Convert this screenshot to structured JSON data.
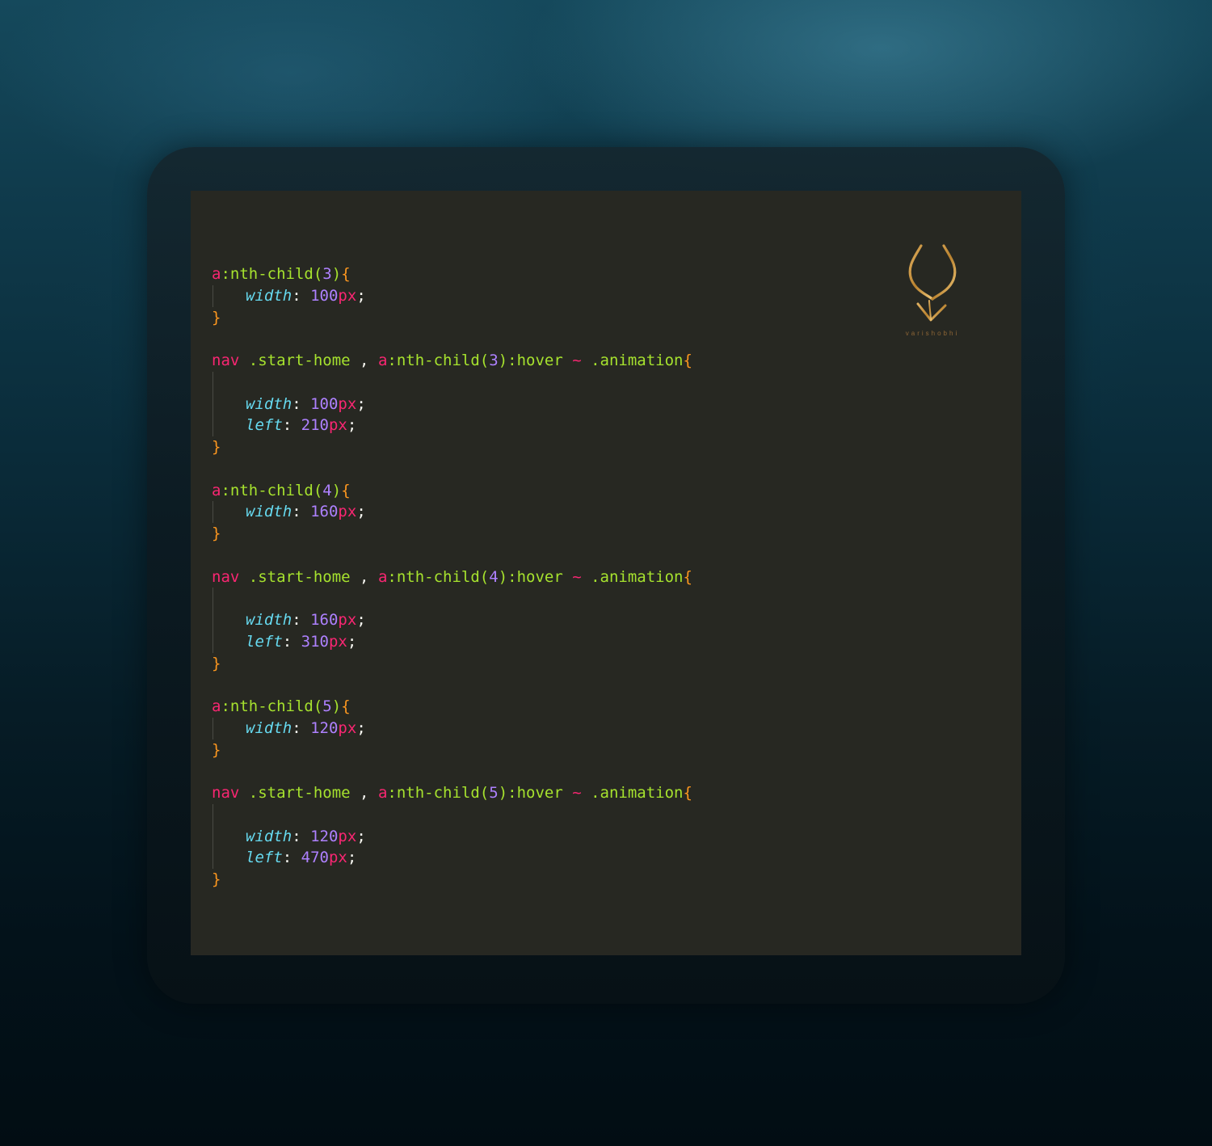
{
  "logo": {
    "icon": "antler-v-logo-icon",
    "text": "varishobhi",
    "color": "#c8923f"
  },
  "colors": {
    "panel_bg": "#272822",
    "tag": "#f92672",
    "selector": "#a6e22e",
    "number": "#ae81ff",
    "property": "#66d9ef",
    "brace": "#fd971f"
  },
  "code": {
    "blocks": [
      {
        "selector": [
          {
            "t": "a",
            "k": "tag"
          },
          {
            "t": ":nth-child(",
            "k": "sel"
          },
          {
            "t": "3",
            "k": "num"
          },
          {
            "t": ")",
            "k": "sel"
          },
          {
            "t": "{",
            "k": "brace"
          }
        ],
        "lines": [
          [
            {
              "t": "width",
              "k": "prop"
            },
            {
              "t": ": ",
              "k": "punc"
            },
            {
              "t": "100",
              "k": "num"
            },
            {
              "t": "px",
              "k": "unit"
            },
            {
              "t": ";",
              "k": "punc"
            }
          ]
        ]
      },
      {
        "selector": [
          {
            "t": "nav",
            "k": "tag"
          },
          {
            "t": " .start-home ",
            "k": "sel"
          },
          {
            "t": ", ",
            "k": "punc"
          },
          {
            "t": "a",
            "k": "tag"
          },
          {
            "t": ":nth-child(",
            "k": "sel"
          },
          {
            "t": "3",
            "k": "num"
          },
          {
            "t": "):hover ",
            "k": "sel"
          },
          {
            "t": "~",
            "k": "tag"
          },
          {
            "t": " .animation",
            "k": "sel"
          },
          {
            "t": "{",
            "k": "brace"
          }
        ],
        "lines": [
          [],
          [
            {
              "t": "width",
              "k": "prop"
            },
            {
              "t": ": ",
              "k": "punc"
            },
            {
              "t": "100",
              "k": "num"
            },
            {
              "t": "px",
              "k": "unit"
            },
            {
              "t": ";",
              "k": "punc"
            }
          ],
          [
            {
              "t": "left",
              "k": "prop"
            },
            {
              "t": ": ",
              "k": "punc"
            },
            {
              "t": "210",
              "k": "num"
            },
            {
              "t": "px",
              "k": "unit"
            },
            {
              "t": ";",
              "k": "punc"
            }
          ]
        ]
      },
      {
        "selector": [
          {
            "t": "a",
            "k": "tag"
          },
          {
            "t": ":nth-child(",
            "k": "sel"
          },
          {
            "t": "4",
            "k": "num"
          },
          {
            "t": ")",
            "k": "sel"
          },
          {
            "t": "{",
            "k": "brace"
          }
        ],
        "lines": [
          [
            {
              "t": "width",
              "k": "prop"
            },
            {
              "t": ": ",
              "k": "punc"
            },
            {
              "t": "160",
              "k": "num"
            },
            {
              "t": "px",
              "k": "unit"
            },
            {
              "t": ";",
              "k": "punc"
            }
          ]
        ]
      },
      {
        "selector": [
          {
            "t": "nav",
            "k": "tag"
          },
          {
            "t": " .start-home ",
            "k": "sel"
          },
          {
            "t": ", ",
            "k": "punc"
          },
          {
            "t": "a",
            "k": "tag"
          },
          {
            "t": ":nth-child(",
            "k": "sel"
          },
          {
            "t": "4",
            "k": "num"
          },
          {
            "t": "):hover ",
            "k": "sel"
          },
          {
            "t": "~",
            "k": "tag"
          },
          {
            "t": " .animation",
            "k": "sel"
          },
          {
            "t": "{",
            "k": "brace"
          }
        ],
        "lines": [
          [],
          [
            {
              "t": "width",
              "k": "prop"
            },
            {
              "t": ": ",
              "k": "punc"
            },
            {
              "t": "160",
              "k": "num"
            },
            {
              "t": "px",
              "k": "unit"
            },
            {
              "t": ";",
              "k": "punc"
            }
          ],
          [
            {
              "t": "left",
              "k": "prop"
            },
            {
              "t": ": ",
              "k": "punc"
            },
            {
              "t": "310",
              "k": "num"
            },
            {
              "t": "px",
              "k": "unit"
            },
            {
              "t": ";",
              "k": "punc"
            }
          ]
        ]
      },
      {
        "selector": [
          {
            "t": "a",
            "k": "tag"
          },
          {
            "t": ":nth-child(",
            "k": "sel"
          },
          {
            "t": "5",
            "k": "num"
          },
          {
            "t": ")",
            "k": "sel"
          },
          {
            "t": "{",
            "k": "brace"
          }
        ],
        "lines": [
          [
            {
              "t": "width",
              "k": "prop"
            },
            {
              "t": ": ",
              "k": "punc"
            },
            {
              "t": "120",
              "k": "num"
            },
            {
              "t": "px",
              "k": "unit"
            },
            {
              "t": ";",
              "k": "punc"
            }
          ]
        ]
      },
      {
        "selector": [
          {
            "t": "nav",
            "k": "tag"
          },
          {
            "t": " .start-home ",
            "k": "sel"
          },
          {
            "t": ", ",
            "k": "punc"
          },
          {
            "t": "a",
            "k": "tag"
          },
          {
            "t": ":nth-child(",
            "k": "sel"
          },
          {
            "t": "5",
            "k": "num"
          },
          {
            "t": "):hover ",
            "k": "sel"
          },
          {
            "t": "~",
            "k": "tag"
          },
          {
            "t": " .animation",
            "k": "sel"
          },
          {
            "t": "{",
            "k": "brace"
          }
        ],
        "lines": [
          [],
          [
            {
              "t": "width",
              "k": "prop"
            },
            {
              "t": ": ",
              "k": "punc"
            },
            {
              "t": "120",
              "k": "num"
            },
            {
              "t": "px",
              "k": "unit"
            },
            {
              "t": ";",
              "k": "punc"
            }
          ],
          [
            {
              "t": "left",
              "k": "prop"
            },
            {
              "t": ": ",
              "k": "punc"
            },
            {
              "t": "470",
              "k": "num"
            },
            {
              "t": "px",
              "k": "unit"
            },
            {
              "t": ";",
              "k": "punc"
            }
          ]
        ]
      }
    ],
    "closing_brace": "}"
  }
}
